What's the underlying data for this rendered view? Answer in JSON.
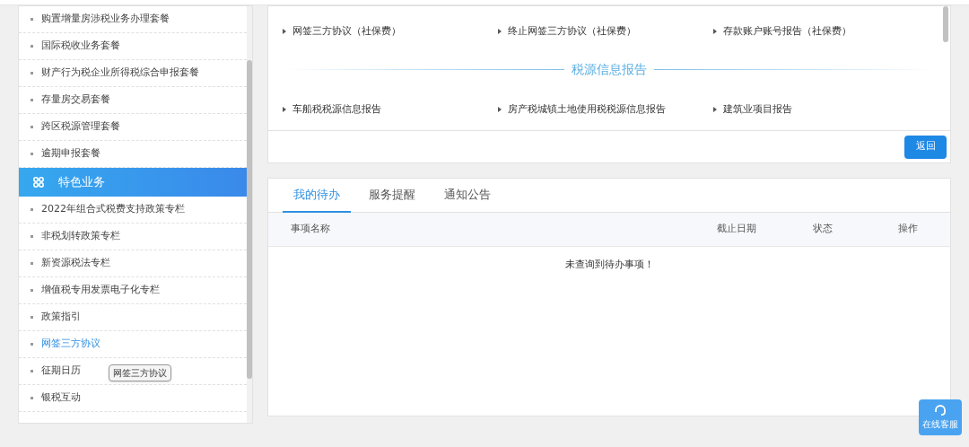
{
  "sidebar": {
    "items_before": [
      {
        "label": "购置增量房涉税业务办理套餐",
        "selected": false
      },
      {
        "label": "国际税收业务套餐",
        "selected": false
      },
      {
        "label": "财产行为税企业所得税综合申报套餐",
        "selected": false
      },
      {
        "label": "存量房交易套餐",
        "selected": false
      },
      {
        "label": "跨区税源管理套餐",
        "selected": false
      },
      {
        "label": "逾期申报套餐",
        "selected": false
      }
    ],
    "section": {
      "label": "特色业务"
    },
    "items": [
      {
        "label": "2022年组合式税费支持政策专栏",
        "selected": false
      },
      {
        "label": "非税划转政策专栏",
        "selected": false
      },
      {
        "label": "新资源税法专栏",
        "selected": false
      },
      {
        "label": "增值税专用发票电子化专栏",
        "selected": false
      },
      {
        "label": "政策指引",
        "selected": false
      },
      {
        "label": "网签三方协议",
        "selected": true
      },
      {
        "label": "征期日历",
        "selected": false
      },
      {
        "label": "银税互动",
        "selected": false
      }
    ],
    "tooltip": {
      "text": "网签三方协议"
    }
  },
  "services": {
    "links_top": [
      "网签三方协议（社保费）",
      "终止网签三方协议（社保费）",
      "存款账户账号报告（社保费）"
    ],
    "section_title": "税源信息报告",
    "links_bottom": [
      "车船税税源信息报告",
      "房产税城镇土地使用税税源信息报告",
      "建筑业项目报告"
    ],
    "back_button": "返回"
  },
  "todo": {
    "tabs": [
      {
        "label": "我的待办",
        "selected": true
      },
      {
        "label": "服务提醒",
        "selected": false
      },
      {
        "label": "通知公告",
        "selected": false
      }
    ],
    "columns": [
      "事项名称",
      "截止日期",
      "状态",
      "操作"
    ],
    "empty_message": "未查询到待办事项！"
  },
  "support_button": "在线客服"
}
